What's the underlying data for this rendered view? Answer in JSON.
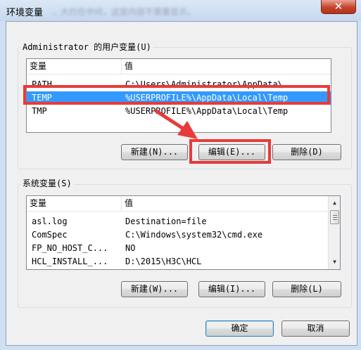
{
  "window": {
    "title": "环境变量",
    "title_suffix_blurred": "，大约在中间，这是内容不需要显示。",
    "close_glyph": "✕"
  },
  "user_vars": {
    "group_label": "Administrator 的用户变量(U)",
    "columns": [
      "变量",
      "值"
    ],
    "rows": [
      {
        "name": "PATH",
        "value": "C:\\Users\\Administrator\\AppData\\...",
        "selected": false
      },
      {
        "name": "TEMP",
        "value": "%USERPROFILE%\\AppData\\Local\\Temp",
        "selected": true
      },
      {
        "name": "TMP",
        "value": "%USERPROFILE%\\AppData\\Local\\Temp",
        "selected": false
      }
    ],
    "buttons": {
      "new": "新建(N)...",
      "edit": "编辑(E)...",
      "delete": "删除(D)"
    }
  },
  "system_vars": {
    "group_label": "系统变量(S)",
    "columns": [
      "变量",
      "值"
    ],
    "rows": [
      {
        "name": "asl.log",
        "value": "Destination=file"
      },
      {
        "name": "ComSpec",
        "value": "C:\\Windows\\system32\\cmd.exe"
      },
      {
        "name": "FP_NO_HOST_C...",
        "value": "NO"
      },
      {
        "name": "HCL_INSTALL_...",
        "value": "D:\\2015\\H3C\\HCL"
      }
    ],
    "buttons": {
      "new": "新建(W)...",
      "edit": "编辑(I)...",
      "delete": "删除(L)"
    }
  },
  "dialog_buttons": {
    "ok": "确定",
    "cancel": "取消"
  },
  "colors": {
    "annotation": "#e83a3a",
    "selection": "#3399ff"
  }
}
